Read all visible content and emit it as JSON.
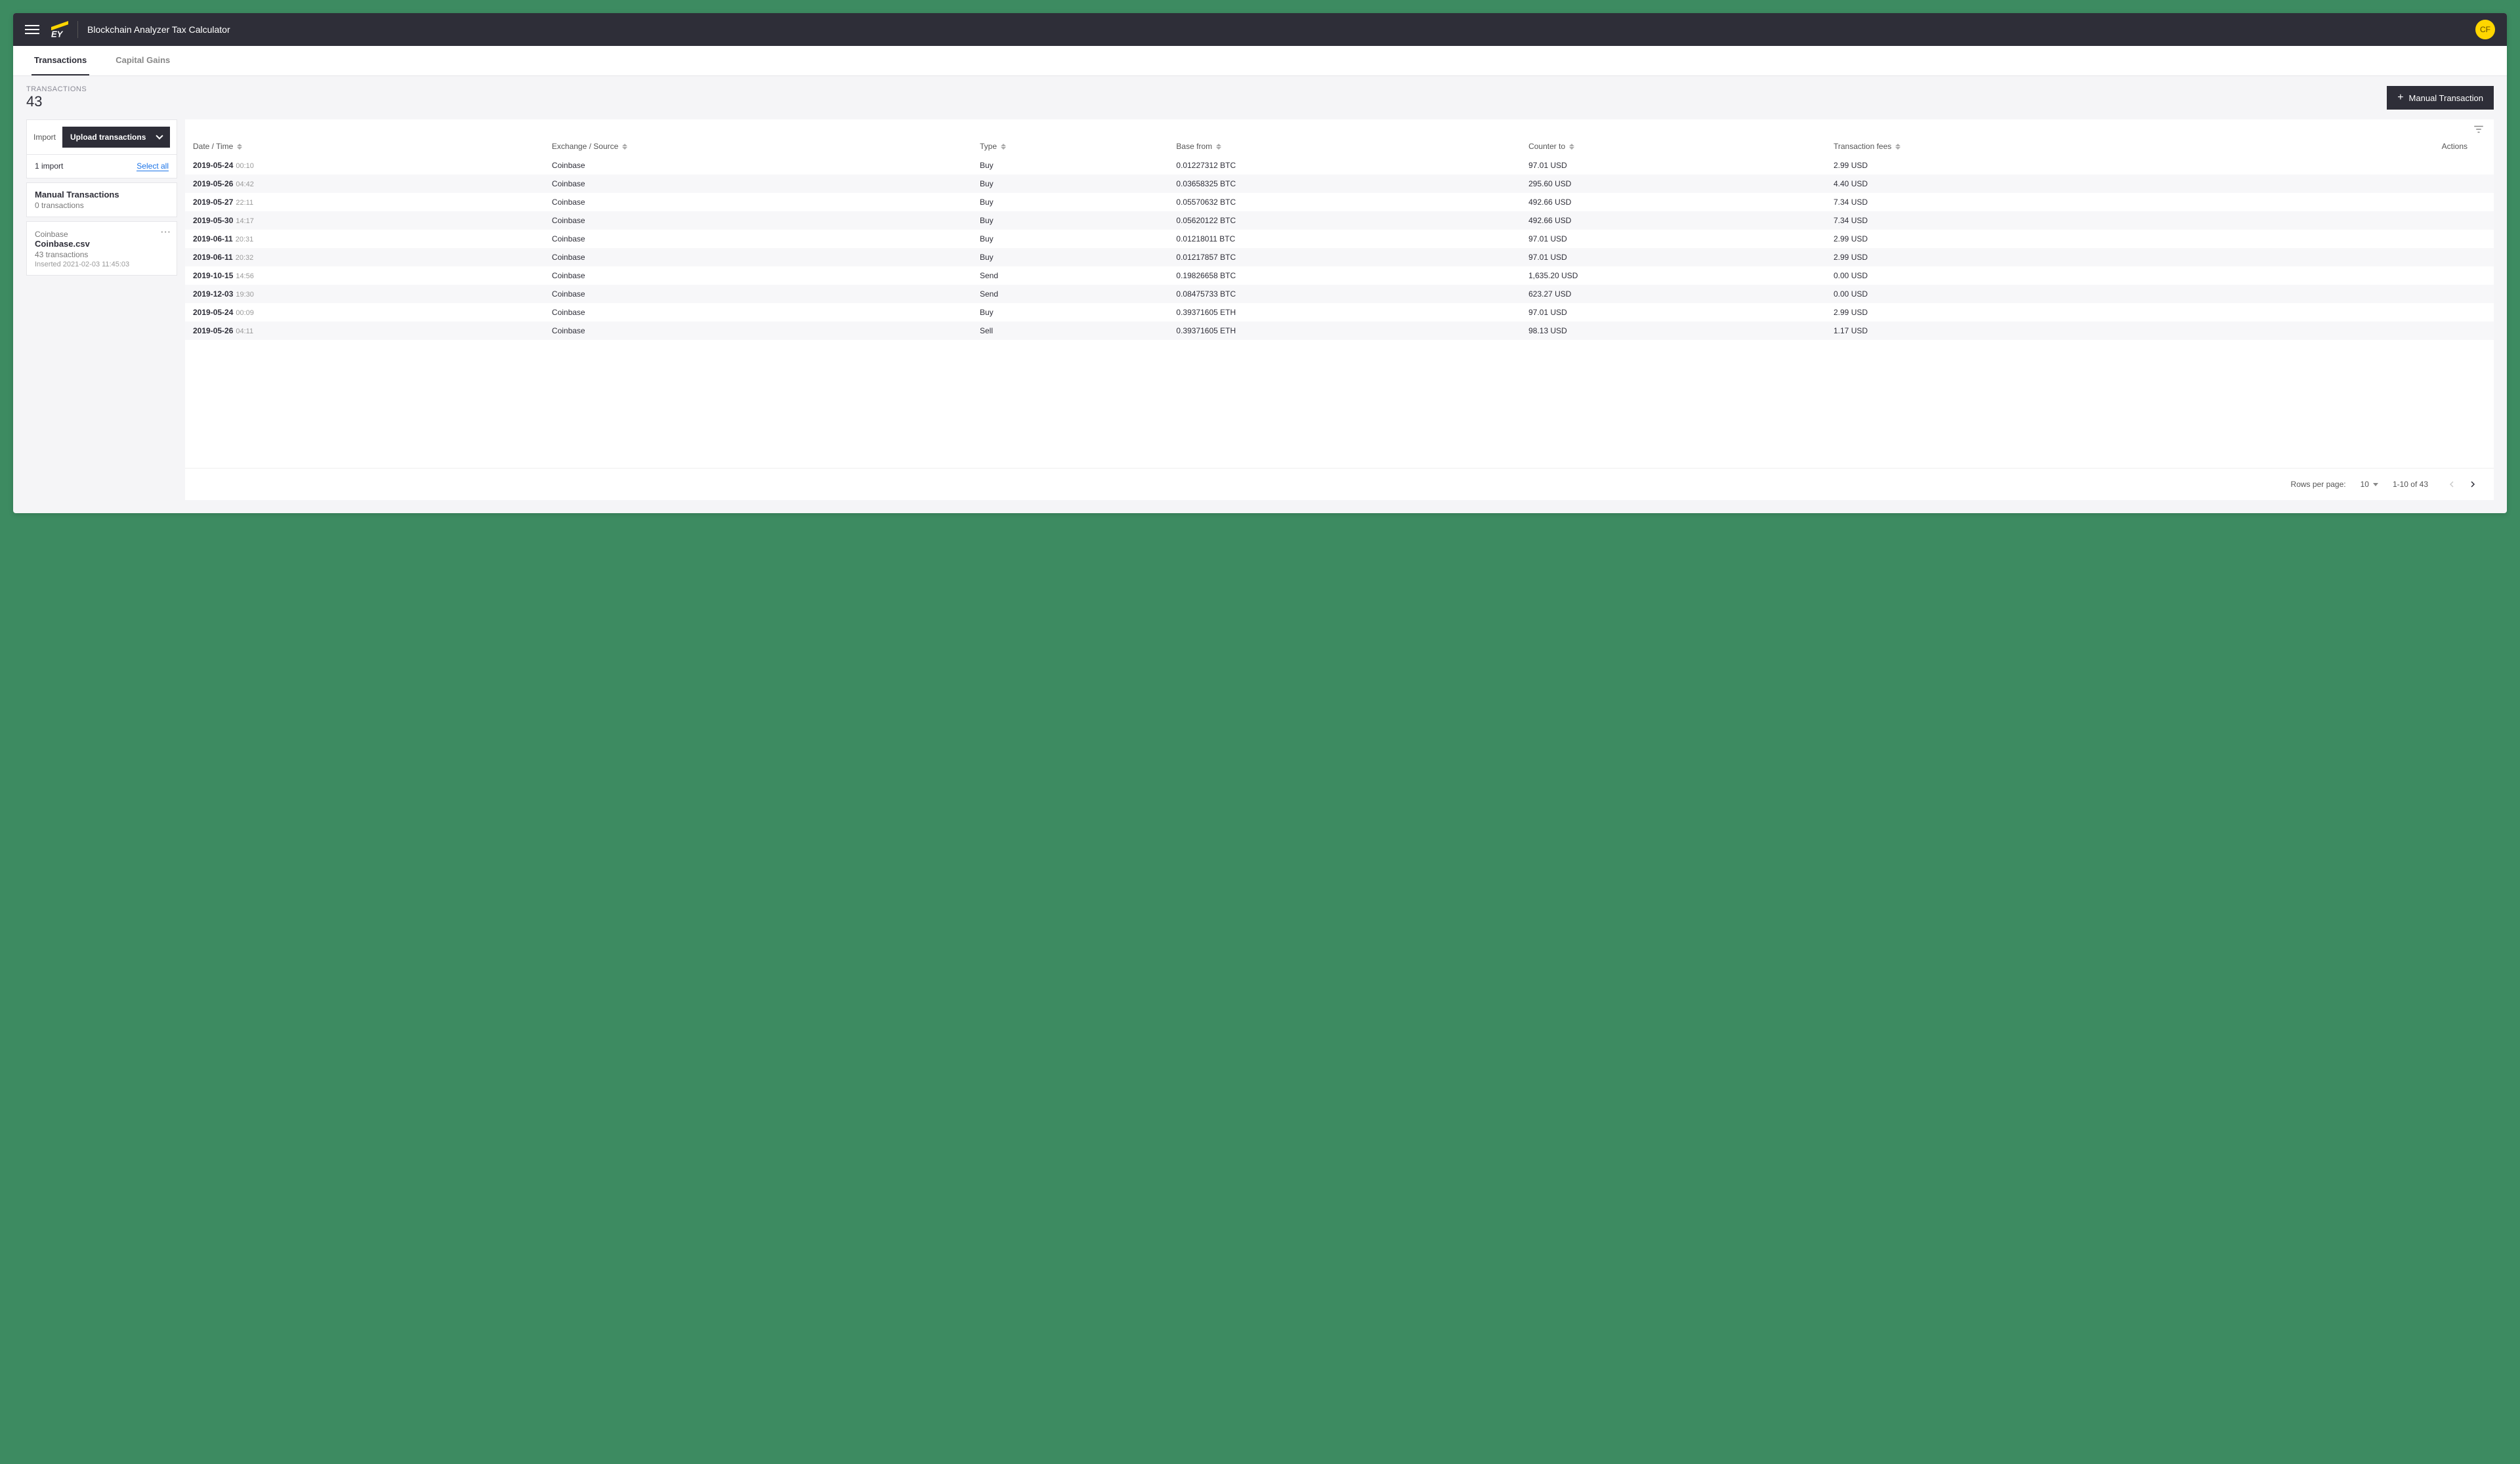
{
  "header": {
    "app_title": "Blockchain Analyzer Tax Calculator",
    "avatar_initials": "CF"
  },
  "tabs": {
    "transactions": "Transactions",
    "capital_gains": "Capital Gains"
  },
  "subheader": {
    "label": "TRANSACTIONS",
    "count": "43",
    "manual_btn": "Manual Transaction"
  },
  "sidebar": {
    "import_label": "Import",
    "upload_btn": "Upload transactions",
    "import_count": "1 import",
    "select_all": "Select all",
    "manual_section": {
      "title": "Manual Transactions",
      "sub": "0 transactions"
    },
    "import_card": {
      "source": "Coinbase",
      "filename": "Coinbase.csv",
      "count": "43 transactions",
      "inserted": "Inserted 2021-02-03 11:45:03"
    }
  },
  "table": {
    "columns": {
      "datetime": "Date / Time",
      "exchange": "Exchange / Source",
      "type": "Type",
      "base": "Base from",
      "counter": "Counter to",
      "fees": "Transaction fees",
      "actions": "Actions"
    },
    "rows": [
      {
        "date": "2019-05-24",
        "time": "00:10",
        "exchange": "Coinbase",
        "type": "Buy",
        "base": "0.01227312 BTC",
        "counter": "97.01 USD",
        "fees": "2.99 USD"
      },
      {
        "date": "2019-05-26",
        "time": "04:42",
        "exchange": "Coinbase",
        "type": "Buy",
        "base": "0.03658325 BTC",
        "counter": "295.60 USD",
        "fees": "4.40 USD"
      },
      {
        "date": "2019-05-27",
        "time": "22:11",
        "exchange": "Coinbase",
        "type": "Buy",
        "base": "0.05570632 BTC",
        "counter": "492.66 USD",
        "fees": "7.34 USD"
      },
      {
        "date": "2019-05-30",
        "time": "14:17",
        "exchange": "Coinbase",
        "type": "Buy",
        "base": "0.05620122 BTC",
        "counter": "492.66 USD",
        "fees": "7.34 USD"
      },
      {
        "date": "2019-06-11",
        "time": "20:31",
        "exchange": "Coinbase",
        "type": "Buy",
        "base": "0.01218011 BTC",
        "counter": "97.01 USD",
        "fees": "2.99 USD"
      },
      {
        "date": "2019-06-11",
        "time": "20:32",
        "exchange": "Coinbase",
        "type": "Buy",
        "base": "0.01217857 BTC",
        "counter": "97.01 USD",
        "fees": "2.99 USD"
      },
      {
        "date": "2019-10-15",
        "time": "14:56",
        "exchange": "Coinbase",
        "type": "Send",
        "base": "0.19826658 BTC",
        "counter": "1,635.20 USD",
        "fees": "0.00 USD"
      },
      {
        "date": "2019-12-03",
        "time": "19:30",
        "exchange": "Coinbase",
        "type": "Send",
        "base": "0.08475733 BTC",
        "counter": "623.27 USD",
        "fees": "0.00 USD"
      },
      {
        "date": "2019-05-24",
        "time": "00:09",
        "exchange": "Coinbase",
        "type": "Buy",
        "base": "0.39371605 ETH",
        "counter": "97.01 USD",
        "fees": "2.99 USD"
      },
      {
        "date": "2019-05-26",
        "time": "04:11",
        "exchange": "Coinbase",
        "type": "Sell",
        "base": "0.39371605 ETH",
        "counter": "98.13 USD",
        "fees": "1.17 USD"
      }
    ]
  },
  "pager": {
    "rows_label": "Rows per page:",
    "per_page": "10",
    "range": "1-10 of 43"
  }
}
